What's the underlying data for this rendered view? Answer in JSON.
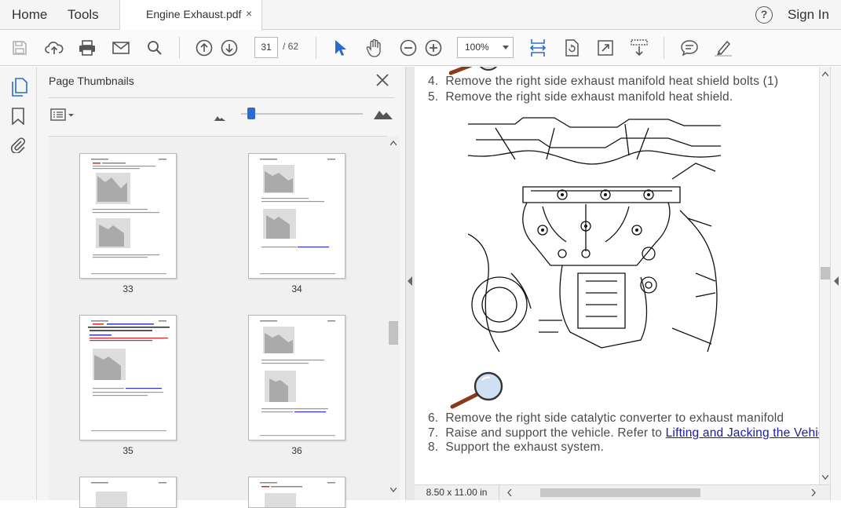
{
  "topbar": {
    "home_label": "Home",
    "tools_label": "Tools",
    "tab_title": "Engine Exhaust.pdf",
    "tab_close": "×",
    "help_label": "?",
    "signin_label": "Sign In"
  },
  "toolbar": {
    "current_page": "31",
    "total_pages": "/ 62",
    "zoom_value": "100%"
  },
  "panel": {
    "title": "Page Thumbnails",
    "thumbnails": [
      {
        "page": "33"
      },
      {
        "page": "34"
      },
      {
        "page": "35"
      },
      {
        "page": "36"
      }
    ]
  },
  "document": {
    "steps": [
      {
        "num": "4.",
        "text": "Remove the right side exhaust manifold heat shield bolts (1)"
      },
      {
        "num": "5.",
        "text": "Remove the right side exhaust manifold heat shield."
      },
      {
        "num": "6.",
        "text": "Remove the right side catalytic converter to exhaust manifold"
      },
      {
        "num": "7.",
        "text": "Raise and support the vehicle. Refer to ",
        "link": "Lifting and Jacking the Vehicle"
      },
      {
        "num": "8.",
        "text": "Support the exhaust system."
      }
    ]
  },
  "status": {
    "page_size": "8.50 x 11.00 in"
  },
  "colors": {
    "accent_blue": "#2a6bd2",
    "link_blue": "#1a1aa6"
  }
}
